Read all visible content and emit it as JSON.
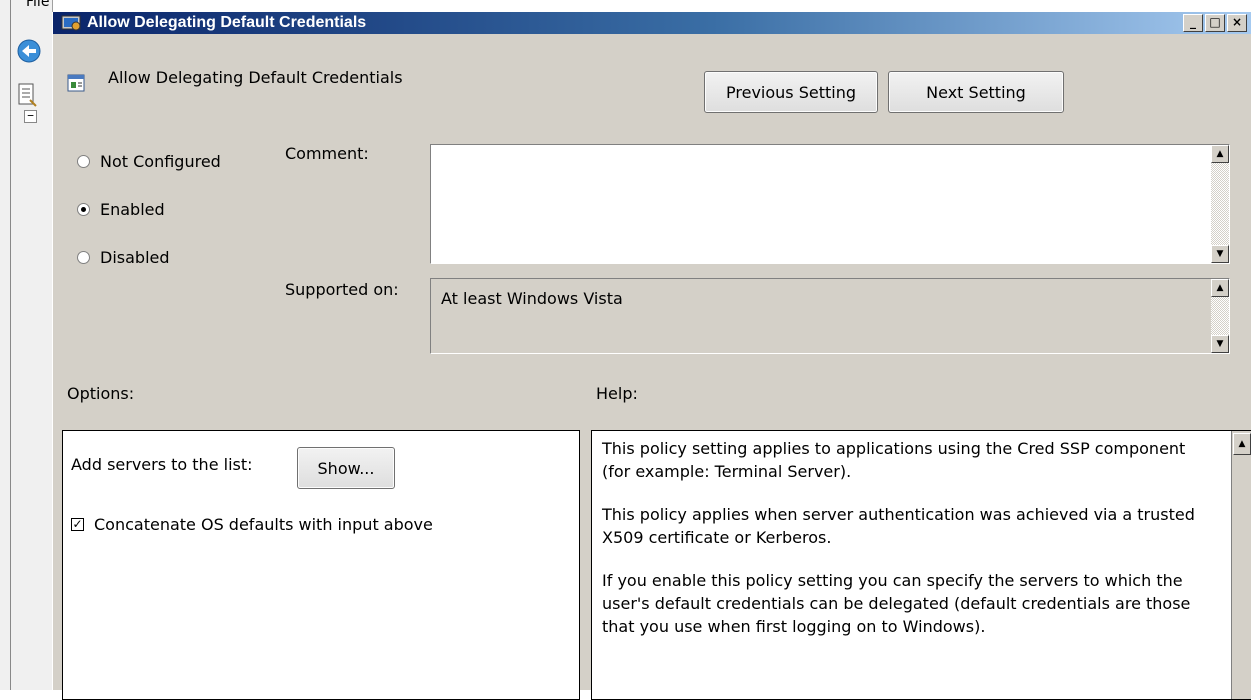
{
  "background_app": {
    "menu_label": "File"
  },
  "window": {
    "title": "Allow Delegating Default Credentials",
    "controls": {
      "minimize": "_",
      "maximize": "□",
      "close": "×"
    }
  },
  "header": {
    "setting_name": "Allow Delegating Default Credentials",
    "previous_button": "Previous Setting",
    "next_button": "Next Setting"
  },
  "state": {
    "options": [
      {
        "label": "Not Configured",
        "checked": false
      },
      {
        "label": "Enabled",
        "checked": true
      },
      {
        "label": "Disabled",
        "checked": false
      }
    ]
  },
  "comment": {
    "label": "Comment:",
    "value": ""
  },
  "supported": {
    "label": "Supported on:",
    "value": "At least Windows Vista"
  },
  "options_section": {
    "label": "Options:",
    "add_servers_label": "Add servers to the list:",
    "show_button": "Show...",
    "concatenate_label": "Concatenate OS defaults with input above",
    "concatenate_checked": true
  },
  "help_section": {
    "label": "Help:",
    "paragraphs": [
      "This policy setting applies to applications using the Cred SSP component (for example: Terminal Server).",
      "This policy applies when server authentication was achieved via a trusted X509 certificate or Kerberos.",
      "If you enable this policy setting you can specify the servers to which the user's default credentials can be delegated (default credentials are those that you use when first logging on to Windows)."
    ]
  },
  "colors": {
    "titlebar_start": "#0a246a",
    "titlebar_end": "#a6caf0",
    "dialog_bg": "#d4d0c8"
  }
}
